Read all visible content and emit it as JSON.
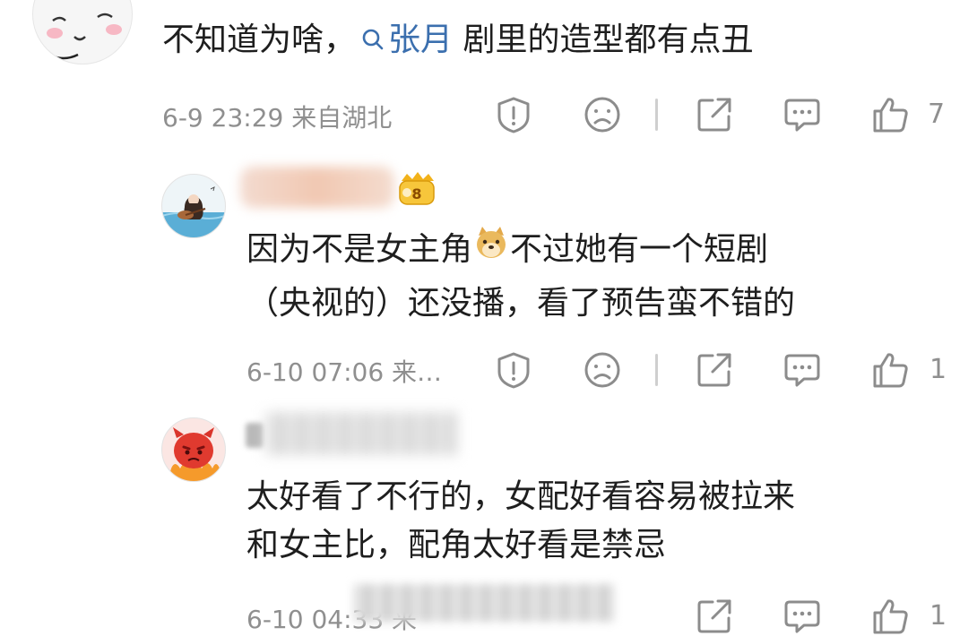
{
  "comments": [
    {
      "text_before": "不知道为啥，",
      "mention": "张月",
      "text_after": " 剧里的造型都有点丑",
      "meta": "6-9 23:29  来自湖北",
      "likes": "7"
    },
    {
      "line1_before": "因为不是女主角",
      "emoji": "doge",
      "line1_after": "不过她有一个短剧",
      "line2": "（央视的）还没播，看了预告蛮不错的",
      "meta": "6-10 07:06  来…",
      "likes": "1"
    },
    {
      "line1": "太好看了不行的，女配好看容易被拉来",
      "line2": "和女主比，配角太好看是禁忌",
      "meta": "6-10 04:33  来",
      "likes": "1"
    }
  ],
  "colors": {
    "mention": "#3b6fae",
    "meta": "#8f8f8f",
    "icon": "#8c8c8c",
    "badge": "#f2b21a"
  },
  "icons": [
    "report-icon",
    "dislike-icon",
    "share-icon",
    "comment-icon",
    "like-icon"
  ]
}
